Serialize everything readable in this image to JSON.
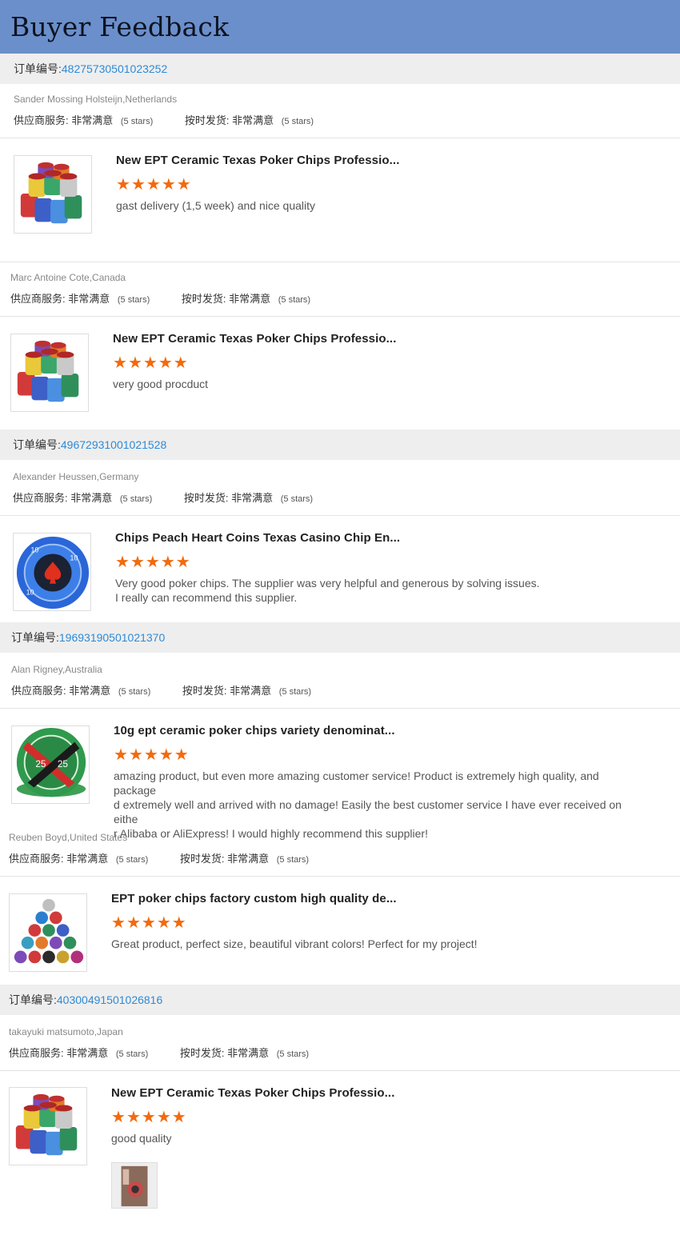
{
  "header": {
    "title": "Buyer Feedback"
  },
  "labels": {
    "order": "订单编号:",
    "supplier_service": "供应商服务:",
    "on_time": "按时发货:"
  },
  "colors": {
    "header_bg": "#6b8fcb",
    "order_bg": "#eeeeee",
    "star": "#f26a0f",
    "order_number": "#2e8ad6"
  },
  "orders": [
    {
      "number": "48275730501023252"
    },
    {
      "number": "49672931001021528"
    },
    {
      "number": "19693190501021370"
    },
    {
      "number": "40300491501026816"
    }
  ],
  "reviews": [
    {
      "buyer": "Sander Mossing Holsteijn,Netherlands",
      "service_value": "非常满意",
      "service_stars": "(5 stars)",
      "ontime_value": "非常满意",
      "ontime_stars": "(5 stars)",
      "product": "New EPT Ceramic Texas Poker Chips Professio...",
      "rating": 5,
      "comment_lines": [
        "gast delivery (1,5 week) and nice quality"
      ],
      "image": "poker-chip-stacks-icon"
    },
    {
      "buyer": "Marc Antoine Cote,Canada",
      "service_value": "非常满意",
      "service_stars": "(5 stars)",
      "ontime_value": "非常满意",
      "ontime_stars": "(5 stars)",
      "product": "New EPT Ceramic Texas Poker Chips Professio...",
      "rating": 5,
      "comment_lines": [
        "very good procduct"
      ],
      "image": "poker-chip-stacks-icon"
    },
    {
      "buyer": "Alexander Heussen,Germany",
      "service_value": "非常满意",
      "service_stars": "(5 stars)",
      "ontime_value": "非常满意",
      "ontime_stars": "(5 stars)",
      "product": "Chips Peach Heart Coins Texas Casino Chip En...",
      "rating": 5,
      "comment_lines": [
        "Very good poker chips. The supplier was very helpful and generous by solving issues.",
        "I really can recommend this supplier."
      ],
      "image": "blue-spade-chip-icon"
    },
    {
      "buyer": "Alan Rigney,Australia",
      "service_value": "非常满意",
      "service_stars": "(5 stars)",
      "ontime_value": "非常满意",
      "ontime_stars": "(5 stars)",
      "product": "10g ept ceramic poker chips variety denominat...",
      "rating": 5,
      "comment_lines": [
        "amazing product, but even more amazing customer service! Product is extremely high quality, and package",
        "d extremely well and arrived with no damage! Easily the best customer service I have ever received on eithe",
        "r Alibaba or AliExpress! I would highly recommend this supplier!"
      ],
      "image": "green-25-chip-icon"
    },
    {
      "buyer": "Reuben Boyd,United States",
      "service_value": "非常满意",
      "service_stars": "(5 stars)",
      "ontime_value": "非常满意",
      "ontime_stars": "(5 stars)",
      "product": "EPT poker chips factory custom high quality de...",
      "rating": 5,
      "comment_lines": [
        "Great product, perfect size, beautiful vibrant colors!  Perfect for my project!"
      ],
      "image": "chip-pyramid-icon"
    },
    {
      "buyer": "takayuki matsumoto,Japan",
      "service_value": "非常满意",
      "service_stars": "(5 stars)",
      "ontime_value": "非常满意",
      "ontime_stars": "(5 stars)",
      "product": "New EPT Ceramic Texas Poker Chips Professio...",
      "rating": 5,
      "comment_lines": [
        "good quality"
      ],
      "image": "poker-chip-stacks-icon"
    }
  ]
}
